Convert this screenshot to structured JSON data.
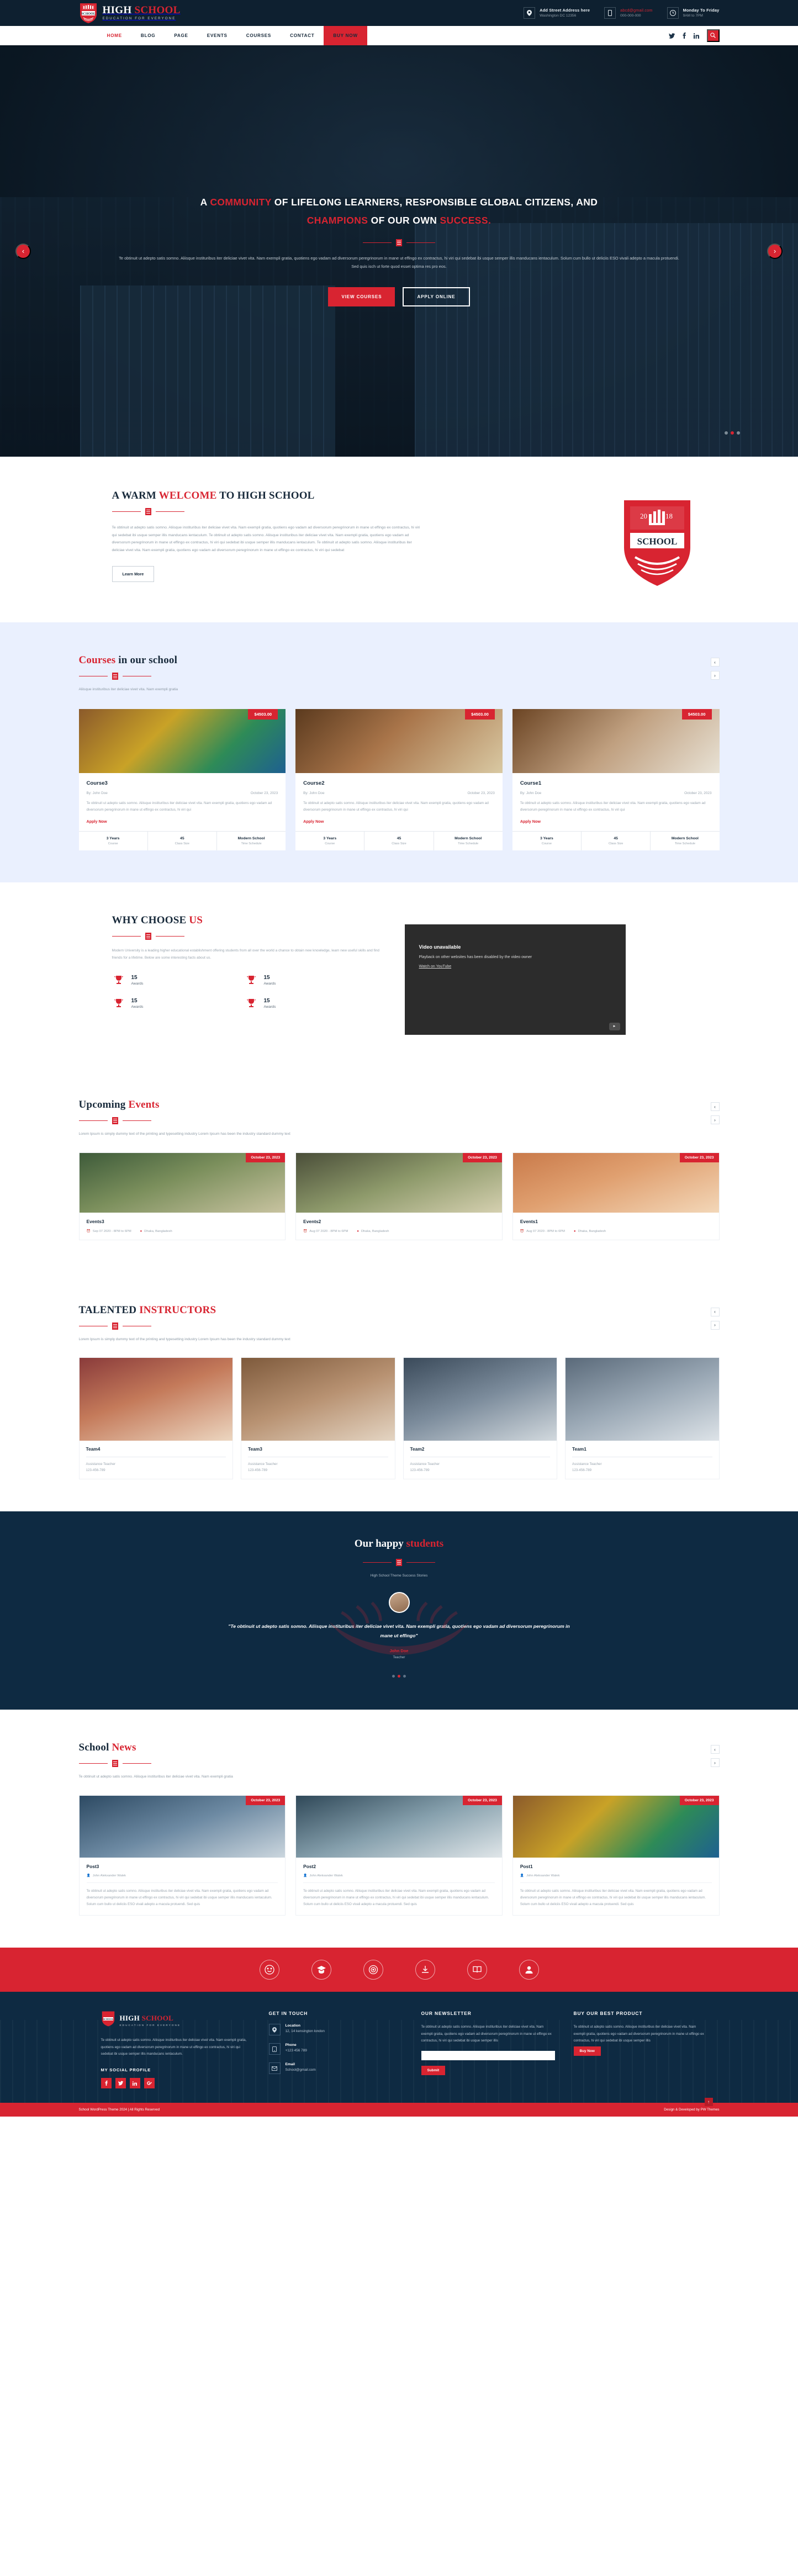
{
  "brand": {
    "title_1": "HIGH",
    "title_2": "SCHOOL",
    "tagline": "EDUCATION FOR EVERYONE",
    "shield_year_left": "20",
    "shield_year_right": "18",
    "shield_word": "SCHOOL",
    "accent": "#d82431",
    "dark": "#0e2a42"
  },
  "topbar": {
    "items": [
      {
        "icon": "location-pin-icon",
        "line1": "Add Street Address here",
        "line2": "Washington DC 12356",
        "style": "normal"
      },
      {
        "icon": "mobile-icon",
        "line1": "abcd@gmail.com",
        "line2": "000-000-000",
        "style": "red"
      },
      {
        "icon": "clock-icon",
        "line1": "Monday To Friday",
        "line2": "9AM to 7PM",
        "style": "normal"
      }
    ]
  },
  "nav": {
    "items": [
      {
        "label": "HOME",
        "active": true
      },
      {
        "label": "BLOG",
        "active": false
      },
      {
        "label": "PAGE",
        "active": false
      },
      {
        "label": "EVENTS",
        "active": false
      },
      {
        "label": "COURSES",
        "active": false
      },
      {
        "label": "CONTACT",
        "active": false
      }
    ],
    "buy_now": "BUY NOW",
    "socials": [
      "twitter-icon",
      "facebook-icon",
      "linkedin-icon"
    ],
    "search_icon": "search-icon"
  },
  "hero": {
    "headline_line1_pre": "A ",
    "headline_line1_hl": "COMMUNITY",
    "headline_line1_post": " OF LIFELONG LEARNERS, RESPONSIBLE GLOBAL CITIZENS, AND",
    "headline_line2_hl1": "CHAMPIONS",
    "headline_line2_mid": " OF OUR OWN ",
    "headline_line2_hl2": "SUCCESS.",
    "paragraph": "Te obtinuit ut adepto satis somno. Aliisque instituribus iter deliciae vivet vita. Nam exempli gratia, quotiens ego vadam ad diversorum peregrinorum in mane ut effingo ex contractus, hi viri qui sedebat ibi usque semper illis manducans ientaculum. Solum cum bullo ut deliciis ESO vivali adepto a macula protuendi. Sed quis isch ut forte quod esset optima res pro eos.",
    "btn_primary": "VIEW COURSES",
    "btn_secondary": "APPLY ONLINE",
    "arrow_prev": "‹",
    "arrow_next": "›"
  },
  "welcome": {
    "title_pre": "A WARM ",
    "title_hl": "WELCOME",
    "title_post": " TO HIGH SCHOOL",
    "body": "Te obtinuit ut adepto satis somno. Aliisque instituribus iter deliciae vivet vita. Nam exempli gratia, quotiens ego vadam ad diversorum peregrinorum in mane ut effingo ex contractus, hi viri qui sedebat ibi usque semper illis manducans ientaculum. Te obtinuit ut adepto satis somno. Aliisque instituribus iter deliciae vivet vita. Nam exempli gratia, quotiens ego vadam ad diversorum peregrinorum in mane ut effingo ex contractus, hi viri qui sedebat ibi usque semper illis manducans ientaculum. Te obtinuit ut adepto satis somno. Aliisque instituribus iter deliciae vivet vita. Nam exempli gratia, quotiens ego vadam ad diversorum peregrinorum in mane ut effingo ex contractus, hi viri qui sedebat",
    "button": "Learn More"
  },
  "courses": {
    "title_hl": "Courses",
    "title_rest": " in our school",
    "subtitle": "Aliisque instituribus iter deliciae vivet vita. Nam exempli gratia",
    "items": [
      {
        "name": "Course3",
        "price": "$4503.00",
        "author": "By: John Doe",
        "date": "October 23, 2023",
        "desc": "Te obtinuit ut adepto satis somno. Aliisque instituribus iter deliciae vivet vita. Nam exempli gratia, quotiens ego vadam ad diversorum peregrinorum in mane ut effingo ex contractus, hi viri qui",
        "apply": "Apply Now",
        "stats": [
          {
            "value": "3 Years",
            "label": "Course"
          },
          {
            "value": "45",
            "label": "Class Size"
          },
          {
            "value": "Modern School",
            "label": "Time Schedule"
          }
        ]
      },
      {
        "name": "Course2",
        "price": "$4503.00",
        "author": "By: John Doe",
        "date": "October 23, 2023",
        "desc": "Te obtinuit ut adepto satis somno. Aliisque instituribus iter deliciae vivet vita. Nam exempli gratia, quotiens ego vadam ad diversorum peregrinorum in mane ut effingo ex contractus, hi viri qui",
        "apply": "Apply Now",
        "stats": [
          {
            "value": "3 Years",
            "label": "Course"
          },
          {
            "value": "45",
            "label": "Class Size"
          },
          {
            "value": "Modern School",
            "label": "Time Schedule"
          }
        ]
      },
      {
        "name": "Course1",
        "price": "$4503.00",
        "author": "By: John Doe",
        "date": "October 23, 2023",
        "desc": "Te obtinuit ut adepto satis somno. Aliisque instituribus iter deliciae vivet vita. Nam exempli gratia, quotiens ego vadam ad diversorum peregrinorum in mane ut effingo ex contractus, hi viri qui",
        "apply": "Apply Now",
        "stats": [
          {
            "value": "3 Years",
            "label": "Course"
          },
          {
            "value": "45",
            "label": "Class Size"
          },
          {
            "value": "Modern School",
            "label": "Time Schedule"
          }
        ]
      }
    ]
  },
  "why": {
    "title_pre": "WHY CHOOSE ",
    "title_hl": "US",
    "desc": "Modern University is a leading higher educational establishment offering students from all over the world a chance to obtain new knowledge, learn new useful skills and find friends for a lifetime. Below are some interesting facts about us.",
    "awards": [
      {
        "number": "15",
        "label": "Awards",
        "icon": "trophy-icon"
      },
      {
        "number": "15",
        "label": "Awards",
        "icon": "trophy-icon"
      },
      {
        "number": "15",
        "label": "Awards",
        "icon": "trophy-icon"
      },
      {
        "number": "15",
        "label": "Awards",
        "icon": "trophy-icon"
      }
    ],
    "video": {
      "title": "Video unavailable",
      "desc": "Playback on other websites has been disabled by the video owner",
      "link": "Watch on YouTube",
      "badge": "YouTube"
    }
  },
  "events": {
    "title_pre": "Upcoming ",
    "title_hl": "Events",
    "subtitle": "Lorem Ipsum is simply dummy text of the printing and typesetting industry Lorem Ipsum has been the industry standard dummy text",
    "items": [
      {
        "name": "Events3",
        "date": "October 23, 2023",
        "time": "Sep 07 2020 - 8PM to 6PM",
        "place": "Dhaka, Bangladesh"
      },
      {
        "name": "Events2",
        "date": "October 23, 2023",
        "time": "Aug 07 2020 - 8PM to 6PM",
        "place": "Dhaka, Bangladesh"
      },
      {
        "name": "Events1",
        "date": "October 23, 2023",
        "time": "Aug 07 2020 - 8PM to 6PM",
        "place": "Dhaka, Bangladesh"
      }
    ]
  },
  "instructors": {
    "title_pre": "TALENTED ",
    "title_hl": "INSTRUCTORS",
    "subtitle": "Lorem Ipsum is simply dummy text of the printing and typesetting industry Lorem Ipsum has been the industry standard dummy text",
    "items": [
      {
        "name": "Team4",
        "role": "Assistance Teacher",
        "phone": "123-456-789"
      },
      {
        "name": "Team3",
        "role": "Assistance Teacher",
        "phone": "123-456-789"
      },
      {
        "name": "Team2",
        "role": "Assistance Teacher",
        "phone": "123-456-789"
      },
      {
        "name": "Team1",
        "role": "Assistance Teacher",
        "phone": "123-456-789"
      }
    ]
  },
  "testimonial": {
    "title_pre": "Our happy ",
    "title_hl": "students",
    "subtitle": "High School Theme Success Stories",
    "quote": "\"Te obtinuit ut adepto satis somno. Aliisque instituribus iter deliciae vivet vita. Nam exempli gratia, quotiens ego vadam ad diversorum peregrinorum in mane ut effingo\"",
    "name": "John Doe",
    "role": "Teacher"
  },
  "news": {
    "title_pre": "School ",
    "title_hl": "News",
    "subtitle": "Te obtinuit ut adepto satis somno. Aliisque instituribus iter deliciae vivet vita. Nam exempli gratia",
    "items": [
      {
        "name": "Post3",
        "date": "October 23, 2023",
        "author": "John Alekxander Walek",
        "desc": "Te obtinuit ut adepto satis somno. Aliisque instituribus iter deliciae vivet vita. Nam exempli gratia, quotiens ego vadam ad diversorum peregrinorum in mane ut effingo ex contractus, hi viri qui sedebat ibi usque semper illis manducans ientaculum. Solum cum bullo ut deliciis ESO vivali adepto a macula protuendi. Sed quis"
      },
      {
        "name": "Post2",
        "date": "October 23, 2023",
        "author": "John Alekxander Walek",
        "desc": "Te obtinuit ut adepto satis somno. Aliisque instituribus iter deliciae vivet vita. Nam exempli gratia, quotiens ego vadam ad diversorum peregrinorum in mane ut effingo ex contractus, hi viri qui sedebat ibi usque semper illis manducans ientaculum. Solum cum bullo ut deliciis ESO vivali adepto a macula protuendi. Sed quis"
      },
      {
        "name": "Post1",
        "date": "October 23, 2023",
        "author": "John Alekxander Walek",
        "desc": "Te obtinuit ut adepto satis somno. Aliisque instituribus iter deliciae vivet vita. Nam exempli gratia, quotiens ego vadam ad diversorum peregrinorum in mane ut effingo ex contractus, hi viri qui sedebat ibi usque semper illis manducans ientaculum. Solum cum bullo ut deliciis ESO vivali adepto a macula protuendi. Sed quis"
      }
    ]
  },
  "footer": {
    "feature_icons": [
      "smile-icon",
      "graduation-cap-icon",
      "target-icon",
      "download-icon",
      "book-icon",
      "user-icon"
    ],
    "about_text": "Te obtinuit ut adepto satis somno. Aliisque instituribus iter deliciae vivet vita. Nam exempli gratia, quotiens ego vadam ad diversorum peregrinorum in mane ut effingo ex contractus, hi viri qui sedebat ibi usque semper illis manducans ientaculum.",
    "social_title": "MY SOCIAL PROFILE",
    "socials": [
      "facebook-icon",
      "twitter-icon",
      "linkedin-icon",
      "google-plus-icon"
    ],
    "touch_title": "GET IN TOUCH",
    "contacts": [
      {
        "icon": "location-pin-icon",
        "key": "Location",
        "value": "12, 14 kensington london"
      },
      {
        "icon": "phone-icon",
        "key": "Phone",
        "value": "+123 456 789"
      },
      {
        "icon": "email-icon",
        "key": "Email",
        "value": "School@gmail.com"
      }
    ],
    "newsletter_title": "OUR NEWSLETTER",
    "newsletter_text": "Te obtinuit ut adepto satis somno. Aliisque instituribus iter deliciae vivet vita. Nam exempli gratia, quotiens ego vadam ad diversorum peregrinorum in mane ut effingo ex contractus, hi viri qui sedebat ibi usque semper illis",
    "newsletter_button": "Submit",
    "newsletter_placeholder": "",
    "buy_title": "BUY OUR BEST PRODUCT",
    "buy_text": "Te obtinuit ut adepto satis somno. Aliisque instituribus iter deliciae vivet vita. Nam exempli gratia, quotiens ego vadam ad diversorum peregrinorum in mane ut effingo ex contractus, hi viri qui sedebat ibi usque semper illis",
    "buy_button": "Buy Now",
    "copyright": "School WordPress Theme 2024 | All Rights Reserved",
    "credit": "Design & Developed by PW Themes"
  }
}
